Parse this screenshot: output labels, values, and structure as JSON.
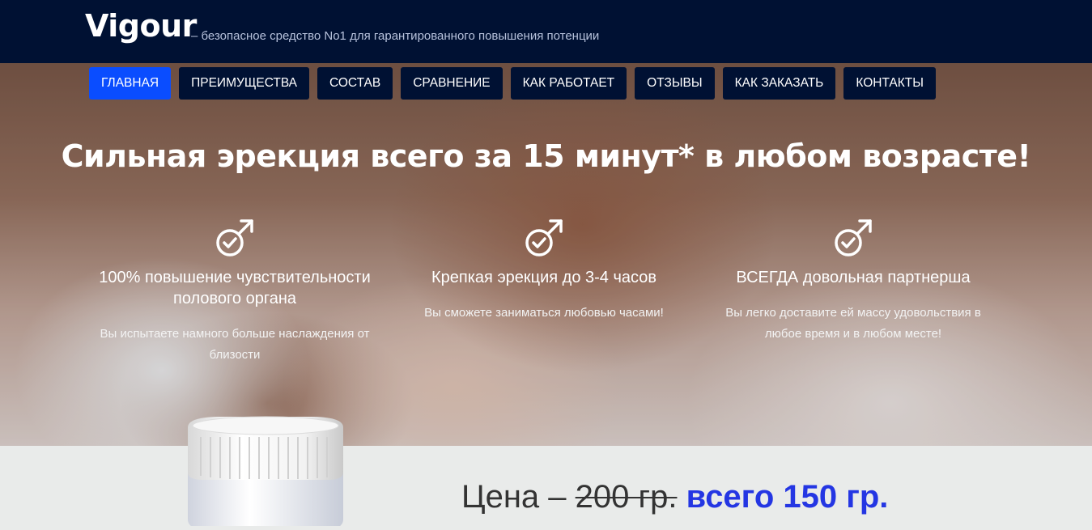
{
  "header": {
    "brand": "Vigour",
    "tagline": "– безопасное средство No1 для гарантированного повышения потенции"
  },
  "nav": {
    "items": [
      "ГЛАВНАЯ",
      "ПРЕИМУЩЕСТВА",
      "СОСТАВ",
      "СРАВНЕНИЕ",
      "КАК РАБОТАЕТ",
      "ОТЗЫВЫ",
      "КАК ЗАКАЗАТЬ",
      "КОНТАКТЫ"
    ],
    "active": "ГЛАВНАЯ"
  },
  "hero": {
    "headline": "Сильная эрекция всего за 15 минут* в любом возрасте!",
    "features": [
      {
        "icon": "male-check-icon",
        "title": "100% повышение чувствительности полового органа",
        "desc": "Вы испытаете намного больше наслаждения от близости"
      },
      {
        "icon": "male-check-icon",
        "title": "Крепкая эрекция до 3-4 часов",
        "desc": "Вы сможете заниматься любовью часами!"
      },
      {
        "icon": "male-check-icon",
        "title": "ВСЕГДА довольная партнерша",
        "desc": "Вы легко доставите ей массу удовольствия в любое время и в любом месте!"
      }
    ]
  },
  "price": {
    "label": "Цена –",
    "old": "200 гр.",
    "new": "всего 150 гр."
  },
  "colors": {
    "header_bg": "#001133",
    "nav_active": "#0a4dff",
    "price_accent": "#2436e3"
  }
}
